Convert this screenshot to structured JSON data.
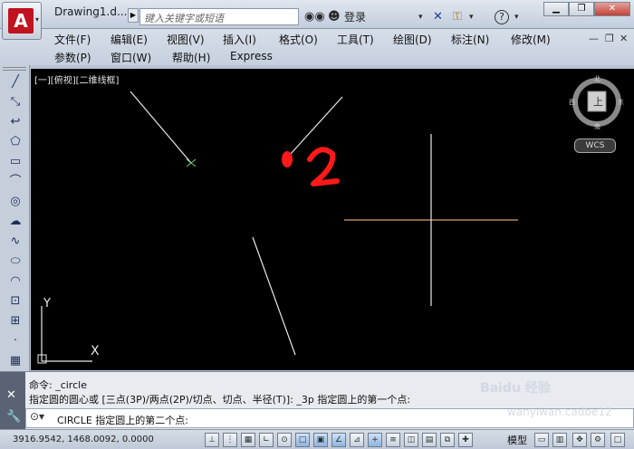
{
  "titlebar": {
    "doc_title": "Drawing1.d...",
    "search_placeholder": "键入关键字或短语",
    "login_label": "登录",
    "app_logo_letter": "A"
  },
  "menus_row1": [
    "文件(F)",
    "编辑(E)",
    "视图(V)",
    "插入(I)",
    "格式(O)",
    "工具(T)",
    "绘图(D)",
    "标注(N)",
    "修改(M)"
  ],
  "menus_row2": [
    "参数(P)",
    "窗口(W)",
    "帮助(H)",
    "Express"
  ],
  "viewport": {
    "view_label": "[一][俯视][二维线框]",
    "compass": {
      "north": "北",
      "south": "南",
      "east": "东",
      "west": "西",
      "center": "上"
    },
    "wcs_label": "WCS",
    "annotation": "2",
    "ucs_y": "Y",
    "ucs_x": "X"
  },
  "command": {
    "history_1": "命令: _circle",
    "history_2": "指定圆的圆心或 [三点(3P)/两点(2P)/切点、切点、半径(T)]: _3p 指定圆上的第一个点:",
    "prompt": "CIRCLE 指定圆上的第二个点:"
  },
  "status": {
    "coordinates": "3916.9542, 1468.0092, 0.0000",
    "model_label": "模型"
  },
  "watermark": {
    "line1": "Baidu 经验",
    "line2": "wanyiwan.cadbe12"
  },
  "colors": {
    "canvas": "#000000",
    "annotation_red": "#ff1a1a",
    "crosshair": "#d9a46a"
  }
}
